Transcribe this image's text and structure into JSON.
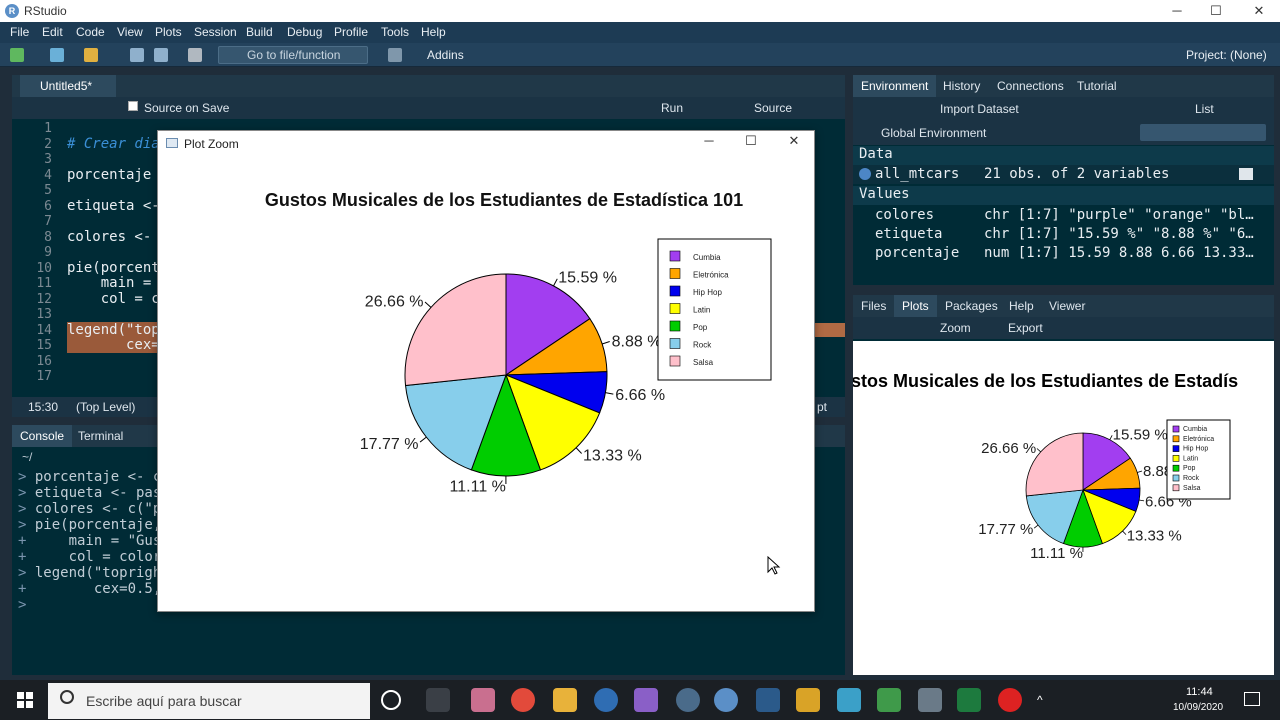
{
  "window": {
    "title": "RStudio",
    "minimize": "─",
    "maximize": "☐",
    "close": "✕"
  },
  "menu": [
    "File",
    "Edit",
    "Code",
    "View",
    "Plots",
    "Session",
    "Build",
    "Debug",
    "Profile",
    "Tools",
    "Help"
  ],
  "toolbar": {
    "goto_placeholder": "Go to file/function",
    "addins": "Addins",
    "project": "Project: (None)"
  },
  "editor": {
    "tab": "Untitled5*",
    "source_on_save": "Source on Save",
    "run": "Run",
    "source": "Source",
    "line_numbers": [
      "1",
      "2",
      "3",
      "4",
      "5",
      "6",
      "7",
      "8",
      "9",
      "10",
      "11",
      "12",
      "13",
      "14",
      "15",
      "16",
      "17"
    ],
    "lines": [
      {
        "n": 2,
        "text": "# Crear dia",
        "comment": true
      },
      {
        "n": 4,
        "text": "porcentaje"
      },
      {
        "n": 6,
        "text": "etiqueta <-"
      },
      {
        "n": 8,
        "text": "colores <- "
      },
      {
        "n": 10,
        "text": "pie(porcent"
      },
      {
        "n": 11,
        "text": "    main = "
      },
      {
        "n": 12,
        "text": "    col = c"
      },
      {
        "n": 14,
        "text": "legend(\"top"
      },
      {
        "n": 15,
        "text": "       cex="
      }
    ],
    "status_pos": "15:30",
    "status_level": "(Top Level)",
    "status_type": "pt"
  },
  "console": {
    "tabs": [
      "Console",
      "Terminal"
    ],
    "path": "~/",
    "lines": [
      {
        "p": ">",
        "t": "porcentaje <- c"
      },
      {
        "p": ">",
        "t": "etiqueta <- pas"
      },
      {
        "p": ">",
        "t": "colores <- c(\"p"
      },
      {
        "p": ">",
        "t": "pie(porcentaje,"
      },
      {
        "p": "+",
        "t": "    main = \"Gus"
      },
      {
        "p": "+",
        "t": "    col = color"
      },
      {
        "p": ">",
        "t": "legend(\"topright"
      },
      {
        "p": "+",
        "t": "       cex=0.5,"
      },
      {
        "p": ">",
        "t": ""
      }
    ]
  },
  "environment": {
    "tabs": [
      "Environment",
      "History",
      "Connections",
      "Tutorial"
    ],
    "import_dataset": "Import Dataset",
    "list": "List",
    "scope": "Global Environment",
    "data_header": "Data",
    "values_header": "Values",
    "data": [
      {
        "name": "all_mtcars",
        "value": "21 obs. of 2 variables"
      }
    ],
    "values": [
      {
        "name": "colores",
        "value": "chr [1:7] \"purple\" \"orange\" \"bl…"
      },
      {
        "name": "etiqueta",
        "value": "chr [1:7] \"15.59 %\" \"8.88 %\" \"6…"
      },
      {
        "name": "porcentaje",
        "value": "num [1:7] 15.59 8.88 6.66 13.33…"
      }
    ]
  },
  "files": {
    "tabs": [
      "Files",
      "Plots",
      "Packages",
      "Help",
      "Viewer"
    ],
    "zoom": "Zoom",
    "export": "Export",
    "preview_title": "stos Musicales de los Estudiantes de Estadís"
  },
  "zoom_window": {
    "title": "Plot Zoom"
  },
  "chart_data": {
    "type": "pie",
    "title": "Gustos Musicales de los Estudiantes de Estadística 101",
    "categories": [
      "Cumbia",
      "Eletrónica",
      "Hip Hop",
      "Latin",
      "Pop",
      "Rock",
      "Salsa"
    ],
    "values": [
      15.59,
      8.88,
      6.66,
      13.33,
      11.11,
      17.77,
      26.66
    ],
    "labels": [
      "15.59 %",
      "8.88 %",
      "6.66 %",
      "13.33 %",
      "11.11 %",
      "17.77 %",
      "26.66 %"
    ],
    "colors": [
      "#a23ef0",
      "#ffa500",
      "#0000ee",
      "#ffff00",
      "#00cd00",
      "#87ceeb",
      "#ffc0cb"
    ],
    "legend": "top-right",
    "start_angle_deg": 90,
    "direction": "clockwise"
  },
  "taskbar": {
    "search_placeholder": "Escribe aquí para buscar",
    "time": "11:44",
    "date": "10/09/2020"
  }
}
